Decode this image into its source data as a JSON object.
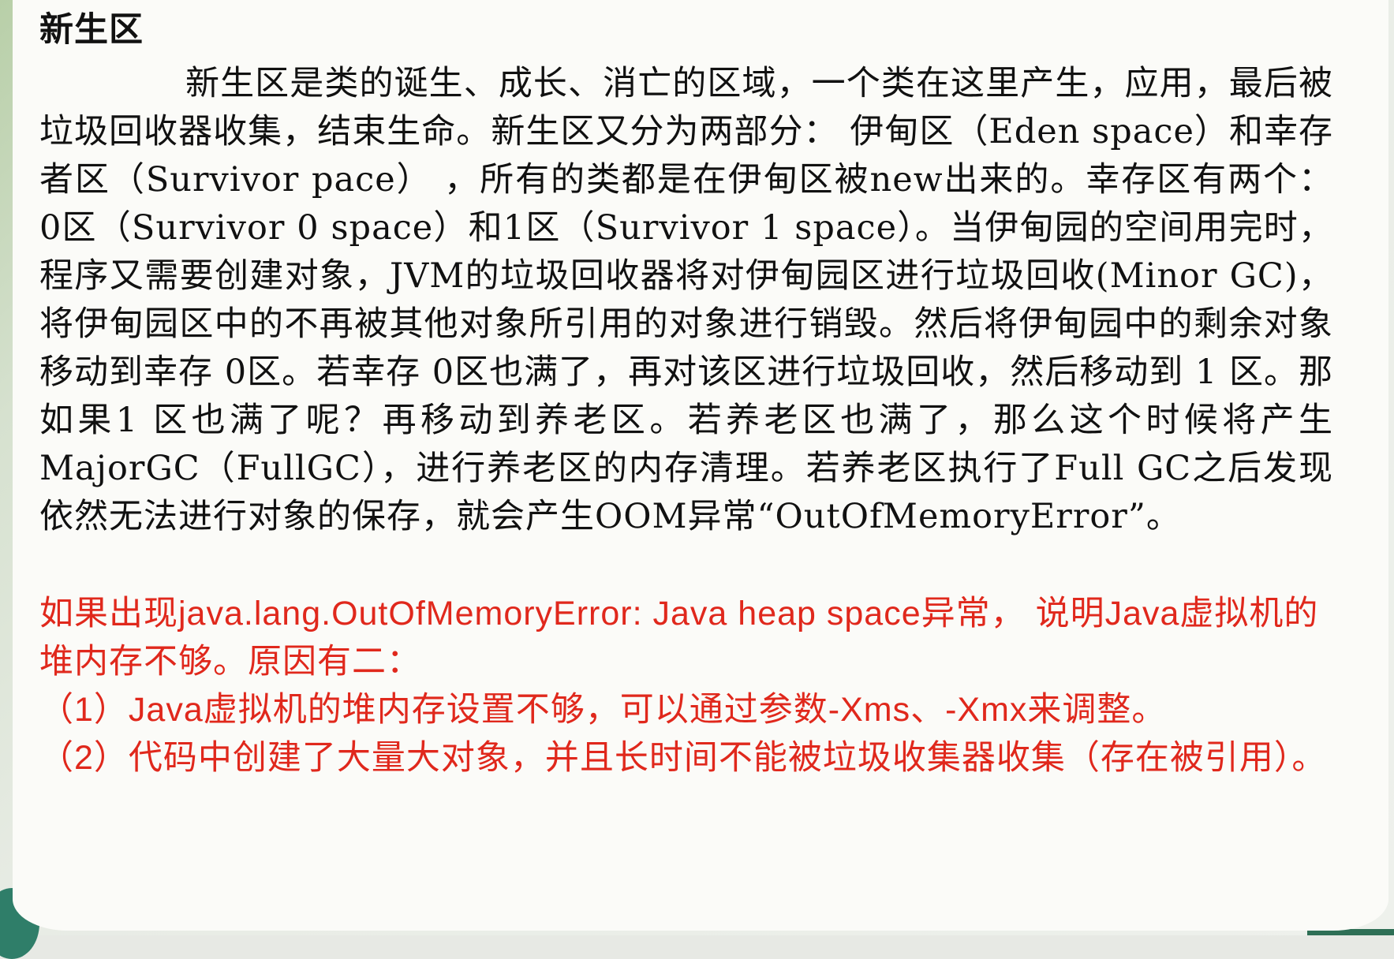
{
  "heading": "新生区",
  "paragraph": "新生区是类的诞生、成长、消亡的区域，一个类在这里产生，应用，最后被垃圾回收器收集，结束生命。新生区又分为两部分： 伊甸区（Eden space）和幸存者区（Survivor pace） ，所有的类都是在伊甸区被new出来的。幸存区有两个： 0区（Survivor 0 space）和1区（Survivor 1 space）。当伊甸园的空间用完时，程序又需要创建对象，JVM的垃圾回收器将对伊甸园区进行垃圾回收(Minor GC)，将伊甸园区中的不再被其他对象所引用的对象进行销毁。然后将伊甸园中的剩余对象移动到幸存 0区。若幸存 0区也满了，再对该区进行垃圾回收，然后移动到 1 区。那如果1 区也满了呢？再移动到养老区。若养老区也满了，那么这个时候将产生MajorGC（FullGC），进行养老区的内存清理。若养老区执行了Full GC之后发现依然无法进行对象的保存，就会产生OOM异常“OutOfMemoryError”。",
  "red_note": {
    "intro": "如果出现java.lang.OutOfMemoryError: Java heap space异常， 说明Java虚拟机的堆内存不够。原因有二：",
    "reason_1": "（1）Java虚拟机的堆内存设置不够，可以通过参数-Xms、-Xmx来调整。",
    "reason_2": "（2）代码中创建了大量大对象，并且长时间不能被垃圾收集器收集（存在被引用）。"
  },
  "colors": {
    "body_text": "#111111",
    "highlight_text": "#e0281c",
    "panel_background": "#fbfbf8"
  }
}
